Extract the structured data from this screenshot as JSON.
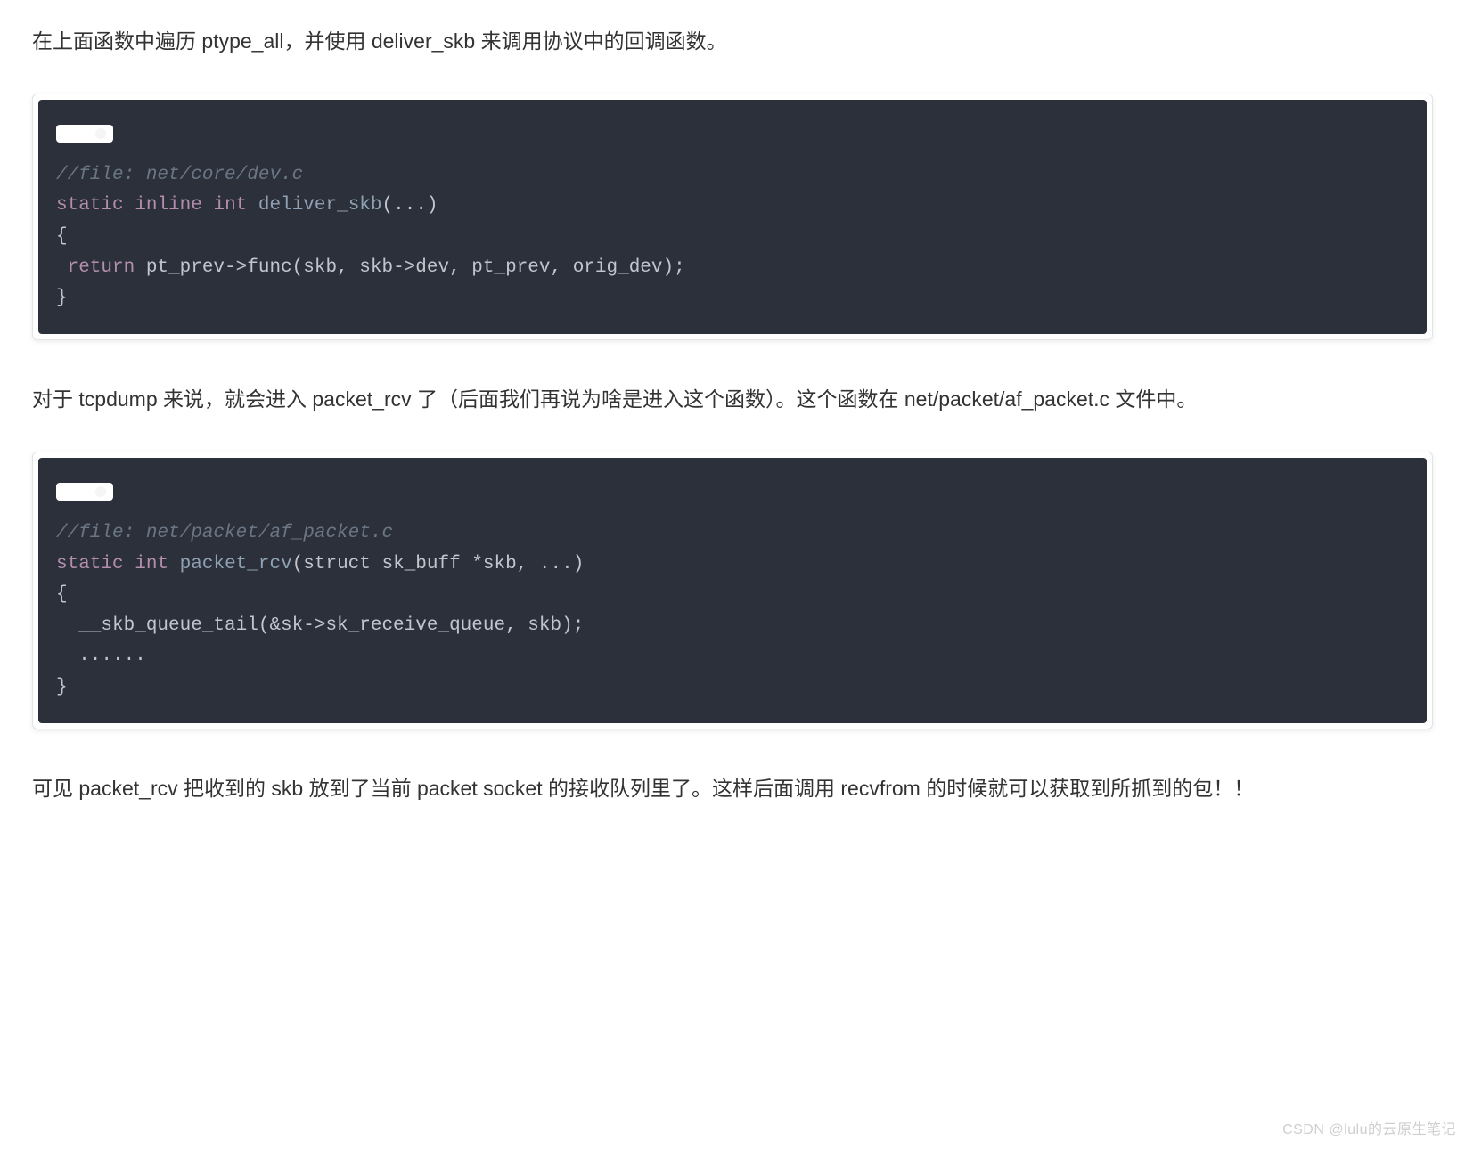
{
  "para1": "在上面函数中遍历 ptype_all，并使用 deliver_skb 来调用协议中的回调函数。",
  "code1": {
    "comment": "//file: net/core/dev.c",
    "l1_kw1": "static",
    "l1_kw2": "inline",
    "l1_ty": "int",
    "l1_fn": "deliver_skb",
    "l1_rest": "(...)",
    "l2": "{",
    "l3_kw": " return",
    "l3_rest": " pt_prev->func(skb, skb->dev, pt_prev, orig_dev);",
    "l4": "}"
  },
  "para2": "对于 tcpdump 来说，就会进入 packet_rcv 了（后面我们再说为啥是进入这个函数）。这个函数在 net/packet/af_packet.c 文件中。",
  "code2": {
    "comment": "//file: net/packet/af_packet.c",
    "l1_kw1": "static",
    "l1_ty": "int",
    "l1_fn": "packet_rcv",
    "l1_rest": "(struct sk_buff *skb, ...)",
    "l2": "{",
    "l3": "  __skb_queue_tail(&sk->sk_receive_queue, skb);",
    "l4": "  ......",
    "l5": "}"
  },
  "para3": "可见 packet_rcv 把收到的 skb 放到了当前 packet socket 的接收队列里了。这样后面调用 recvfrom 的时候就可以获取到所抓到的包！！",
  "watermark": "CSDN @lulu的云原生笔记"
}
